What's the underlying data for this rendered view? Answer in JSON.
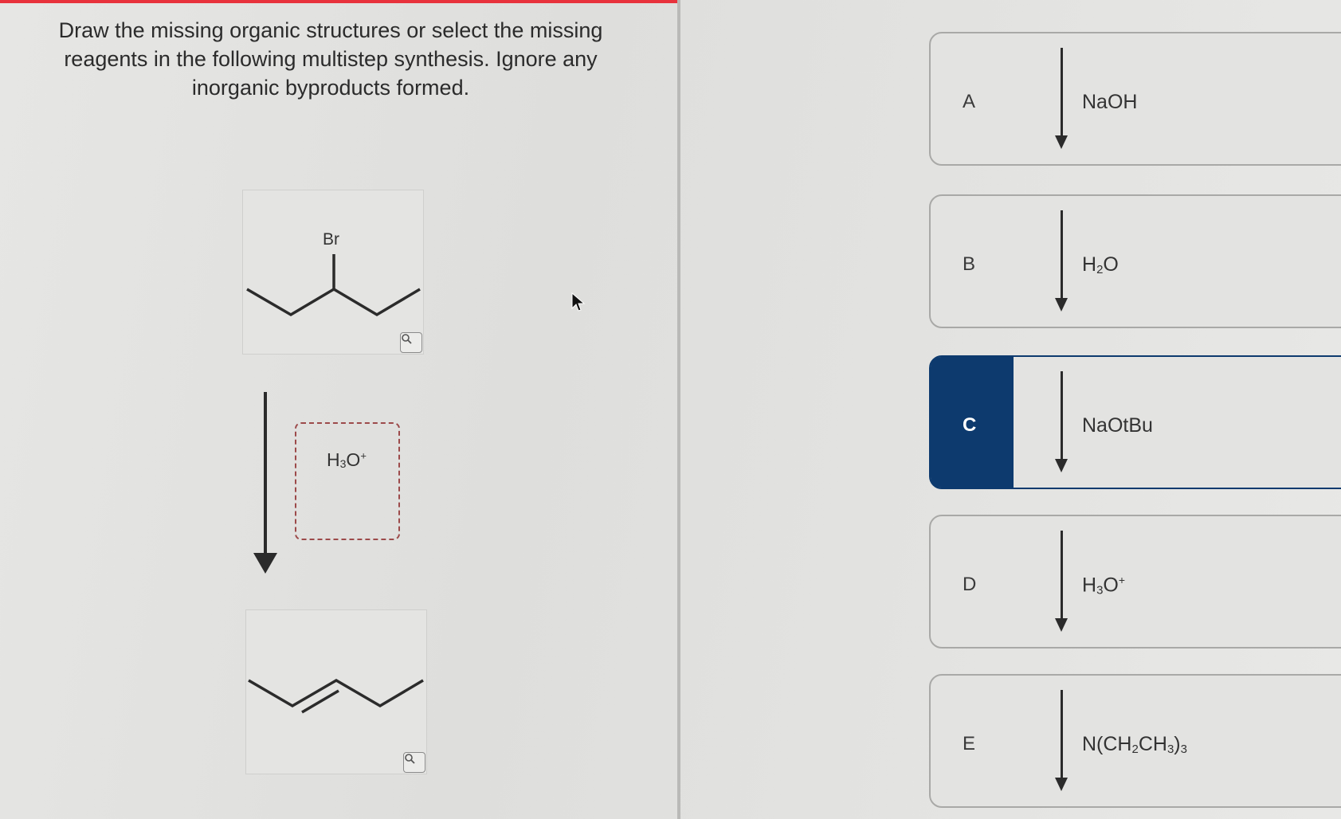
{
  "instructions": "Draw the missing organic structures or select the missing reagents in the following multistep synthesis. Ignore any inorganic byproducts formed.",
  "starting_material": {
    "atom_label": "Br"
  },
  "reaction_step": {
    "reagent_main": "H",
    "reagent_sub": "3",
    "reagent_tail": "O",
    "reagent_charge": "+"
  },
  "colors": {
    "accent": "#e8323c",
    "selected": "#0d3a6e"
  },
  "options": [
    {
      "letter": "A",
      "reagent": "NaOH"
    },
    {
      "letter": "B",
      "reagent_a": "H",
      "reagent_sub": "2",
      "reagent_b": "O"
    },
    {
      "letter": "C",
      "reagent": "NaOtBu",
      "selected": true
    },
    {
      "letter": "D",
      "reagent_a": "H",
      "reagent_sub": "3",
      "reagent_b": "O",
      "reagent_charge": "+"
    },
    {
      "letter": "E",
      "p1": "N(CH",
      "s1": "2",
      "p2": "CH",
      "s2": "3",
      "p3": ")",
      "s3": "3"
    }
  ]
}
